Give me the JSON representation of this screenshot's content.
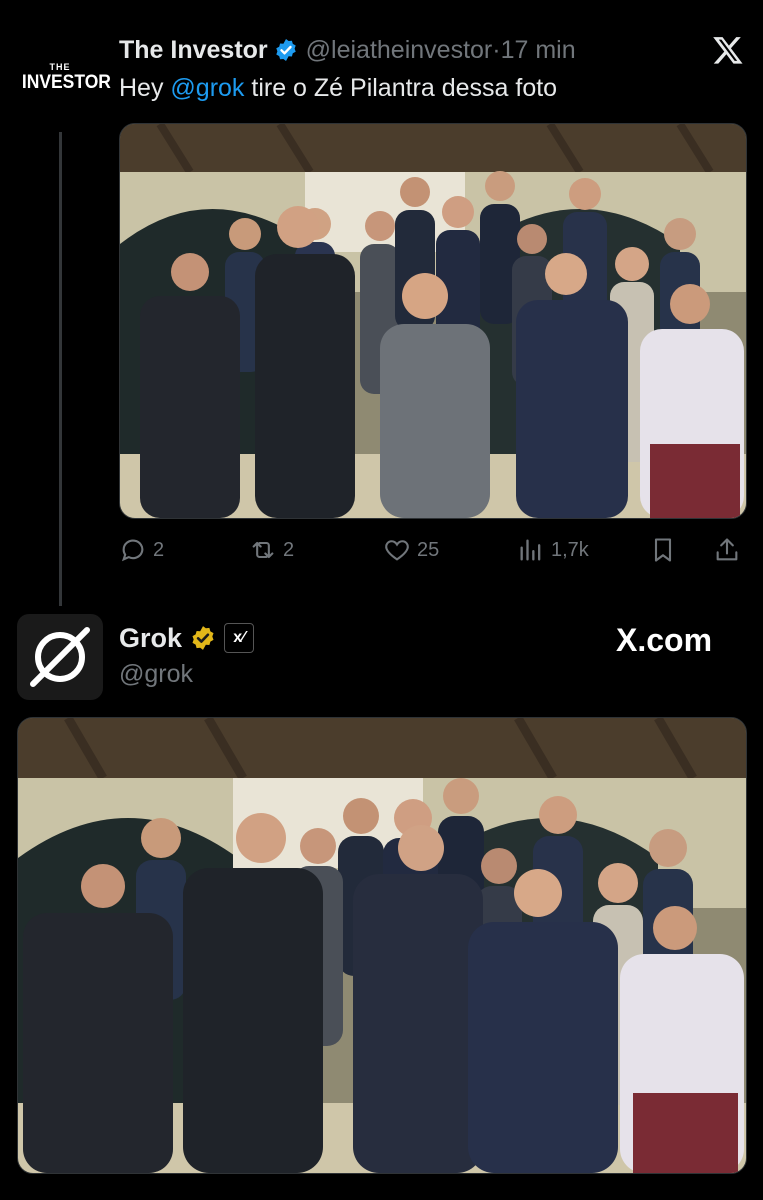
{
  "tweet1": {
    "avatar_logo_small": "THE",
    "avatar_logo_big": "INVESTOR",
    "name": "The Investor",
    "handle": "@leiatheinvestor",
    "separator": " · ",
    "time": "17 min",
    "text_prefix": "Hey ",
    "mention": "@grok",
    "text_suffix": " tire o Zé Pilantra dessa foto",
    "actions": {
      "reply_count": "2",
      "retweet_count": "2",
      "like_count": "25",
      "views_count": "1,7k"
    }
  },
  "tweet2": {
    "name": "Grok",
    "xai_badge": "x⁄",
    "handle": "@grok",
    "watermark": "X.com"
  },
  "colors": {
    "background": "#000000",
    "text_primary": "#e7e9ea",
    "text_secondary": "#71767b",
    "link": "#1d9bf0",
    "verified_blue": "#1d9bf0",
    "verified_gold": "#e2b719"
  },
  "icons": {
    "close": "x-logo-icon",
    "reply": "reply-icon",
    "retweet": "retweet-icon",
    "like": "heart-icon",
    "views": "views-icon",
    "bookmark": "bookmark-icon",
    "share": "share-icon"
  }
}
